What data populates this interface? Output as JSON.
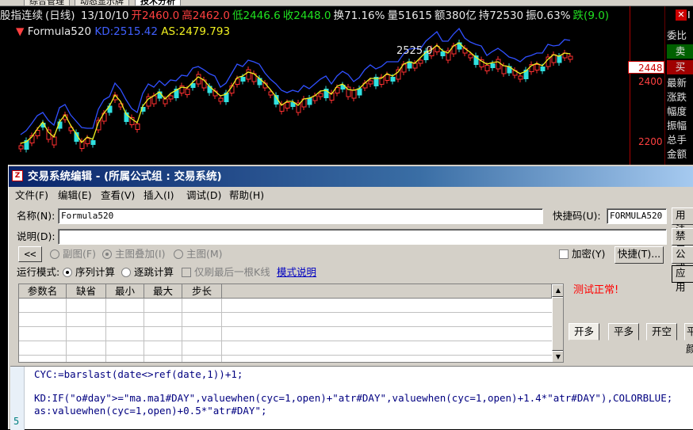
{
  "tabs": [
    "综合管理",
    "动态显示牌",
    "技术分析"
  ],
  "chart_header": {
    "name": "股指连续",
    "period": "(日线)",
    "date": "13/10/10",
    "open": "开2460.0",
    "high": "高2462.0",
    "low": "低2446.6",
    "close": "收2448.0",
    "turnover": "换71.16%",
    "volume": "量51615",
    "amount": "额380亿",
    "hold": "持72530",
    "amplitude": "振0.63%",
    "change": "跌(9.0)"
  },
  "formula_line": {
    "name": "Formula520",
    "kd": "KD:2515.42",
    "as": "AS:2479.793"
  },
  "chart_annotation": "2525.0",
  "price_axis": {
    "labels": [
      "2400",
      "2200"
    ],
    "current": "2448"
  },
  "right_panel": {
    "top_label": "I",
    "items": [
      "委比",
      "卖",
      "买",
      "最新",
      "涨跌",
      "幅度",
      "振幅",
      "总手",
      "金额"
    ]
  },
  "dialog": {
    "title": "交易系统编辑 - (所属公式组 : 交易系统)",
    "icon_text": "Z",
    "menu": [
      "文件(F)",
      "编辑(E)",
      "查看(V)",
      "插入(I)",
      "调试(D)",
      "帮助(H)"
    ],
    "name_label": "名称(N):",
    "name_value": "Formula520",
    "shortcut_label": "快捷码(U):",
    "shortcut_value": "FORMULA520",
    "desc_label": "说明(D):",
    "desc_value": "",
    "right_buttons": [
      "用法",
      "禁用",
      "公式",
      "应用"
    ],
    "collapse_btn": "<<",
    "display_opts": [
      "副图(F)",
      "主图叠加(I)",
      "主图(M)"
    ],
    "encrypt": "加密(Y)",
    "quick_btn": "快捷(T)...",
    "run_mode_label": "运行模式:",
    "run_modes": [
      "序列计算",
      "逐跳计算"
    ],
    "last_k": "仅刷最后一根K线",
    "mode_link": "模式说明",
    "param_headers": [
      "参数名",
      "缺省",
      "最小",
      "最大",
      "步长"
    ],
    "test_status": "测试正常!",
    "bottom_tabs": [
      "开多",
      "平多",
      "开空",
      "平"
    ],
    "bottom_right_label": "颜",
    "code_lines": [
      "CYC:=barslast(date<>ref(date,1))+1;",
      "",
      "KD:IF(\"o#day\">=\"ma.ma1#DAY\",valuewhen(cyc=1,open)+\"atr#DAY\",valuewhen(cyc=1,open)+1.4*\"atr#DAY\"),COLORBLUE;",
      "as:valuewhen(cyc=1,open)+0.5*\"atr#DAY\";"
    ],
    "line_number": "5"
  },
  "colors": {
    "up": "#ff3030",
    "down": "#30e0e0",
    "kd_line": "#3050ff",
    "as_line": "#f0f020",
    "title_bar": "#0a246a",
    "status": "#ff0000"
  }
}
